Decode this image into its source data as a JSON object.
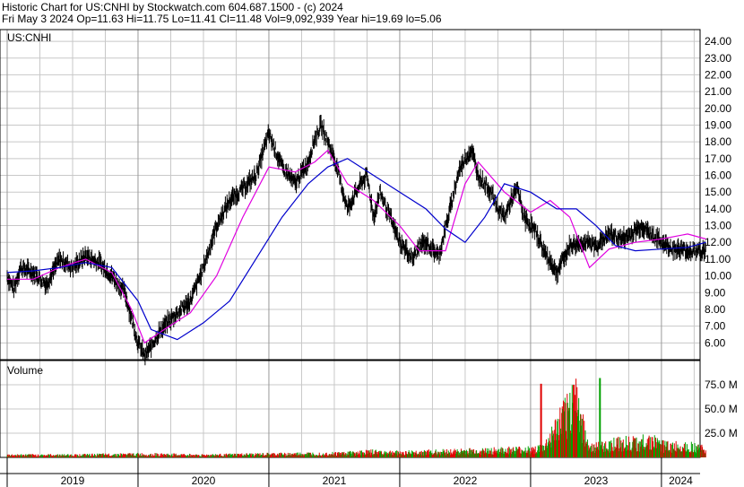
{
  "header": {
    "line1": "Historic Chart for US:CNHI by Stockwatch.com 604.687.1500 - (c) 2024",
    "line2": "Fri May  3 2024   Op=11.63  Hi=11.75  Lo=11.41  Cl=11.48  Vol=9,092,939  Year hi=19.69  lo=5.06"
  },
  "colors": {
    "price_bar": "#000000",
    "ma_short": "#e000e0",
    "ma_long": "#0000cc",
    "vol_up": "#00a000",
    "vol_down": "#e00000",
    "grid": "#c8c8c8"
  },
  "chart_data": [
    {
      "type": "line",
      "title": "US:CNHI",
      "ylim": [
        5,
        24.7
      ],
      "y_ticks": [
        "24.00",
        "23.00",
        "22.00",
        "21.00",
        "20.00",
        "19.00",
        "18.00",
        "17.00",
        "16.00",
        "15.00",
        "14.00",
        "13.00",
        "12.00",
        "11.00",
        "10.00",
        "9.00",
        "8.00",
        "7.00",
        "6.00"
      ],
      "x_ticks": [
        "2019",
        "2020",
        "2021",
        "2022",
        "2023",
        "2024"
      ],
      "x_range": [
        2019.0,
        2024.35
      ],
      "series": [
        {
          "key": "price",
          "x": [
            2019.0,
            2019.05,
            2019.1,
            2019.2,
            2019.3,
            2019.4,
            2019.5,
            2019.6,
            2019.7,
            2019.8,
            2019.9,
            2020.0,
            2020.05,
            2020.1,
            2020.15,
            2020.2,
            2020.25,
            2020.3,
            2020.4,
            2020.5,
            2020.6,
            2020.7,
            2020.8,
            2020.9,
            2021.0,
            2021.1,
            2021.2,
            2021.3,
            2021.35,
            2021.4,
            2021.5,
            2021.6,
            2021.7,
            2021.75,
            2021.8,
            2021.85,
            2021.9,
            2022.0,
            2022.1,
            2022.15,
            2022.2,
            2022.3,
            2022.4,
            2022.45,
            2022.5,
            2022.55,
            2022.6,
            2022.7,
            2022.75,
            2022.8,
            2022.85,
            2022.9,
            2022.95,
            2023.0,
            2023.05,
            2023.1,
            2023.2,
            2023.3,
            2023.4,
            2023.5,
            2023.6,
            2023.7,
            2023.75,
            2023.8,
            2023.85,
            2023.9,
            2024.0,
            2024.1,
            2024.2,
            2024.25,
            2024.3,
            2024.34
          ],
          "values": [
            10.0,
            9.2,
            10.5,
            10.2,
            9.5,
            11.0,
            10.5,
            11.2,
            10.8,
            10.0,
            9.0,
            6.0,
            5.2,
            5.8,
            6.5,
            7.0,
            7.4,
            7.8,
            8.5,
            10.5,
            13.0,
            14.5,
            15.2,
            16.0,
            18.5,
            16.5,
            15.5,
            16.8,
            18.2,
            19.0,
            17.0,
            14.0,
            15.5,
            16.0,
            13.5,
            15.0,
            14.0,
            12.0,
            11.0,
            11.8,
            12.0,
            11.2,
            14.5,
            16.2,
            17.0,
            17.5,
            16.0,
            15.0,
            14.0,
            13.5,
            14.5,
            15.2,
            13.5,
            13.0,
            12.5,
            11.5,
            10.2,
            11.8,
            12.0,
            11.8,
            12.5,
            12.2,
            12.4,
            12.7,
            13.0,
            12.6,
            12.0,
            11.6,
            11.5,
            11.5,
            11.5,
            11.48
          ]
        },
        {
          "key": "ma_short",
          "name": "",
          "x": [
            2019.0,
            2019.2,
            2019.4,
            2019.6,
            2019.8,
            2019.95,
            2020.05,
            2020.2,
            2020.4,
            2020.6,
            2020.8,
            2021.0,
            2021.2,
            2021.35,
            2021.45,
            2021.6,
            2021.8,
            2022.0,
            2022.15,
            2022.35,
            2022.5,
            2022.6,
            2022.8,
            2023.0,
            2023.15,
            2023.3,
            2023.45,
            2023.6,
            2023.8,
            2024.0,
            2024.2,
            2024.34
          ],
          "values": [
            9.8,
            9.8,
            10.5,
            11.0,
            10.2,
            8.0,
            6.0,
            6.8,
            7.8,
            10.0,
            13.5,
            16.5,
            16.2,
            16.8,
            17.5,
            15.5,
            14.5,
            13.0,
            11.5,
            11.5,
            15.5,
            16.8,
            15.0,
            13.8,
            14.5,
            13.5,
            10.5,
            11.6,
            12.0,
            12.2,
            12.5,
            12.2
          ]
        },
        {
          "key": "ma_long",
          "name": "",
          "x": [
            2019.0,
            2019.2,
            2019.4,
            2019.6,
            2019.8,
            2020.0,
            2020.1,
            2020.3,
            2020.5,
            2020.7,
            2020.9,
            2021.1,
            2021.3,
            2021.45,
            2021.6,
            2021.8,
            2022.0,
            2022.2,
            2022.35,
            2022.5,
            2022.65,
            2022.8,
            2023.0,
            2023.2,
            2023.35,
            2023.5,
            2023.65,
            2023.8,
            2024.0,
            2024.2,
            2024.34
          ],
          "values": [
            10.2,
            10.3,
            10.5,
            10.8,
            10.5,
            8.5,
            6.8,
            6.2,
            7.2,
            8.5,
            11.0,
            13.5,
            15.5,
            16.5,
            17.0,
            16.0,
            15.0,
            14.0,
            12.8,
            12.0,
            13.5,
            15.5,
            15.0,
            14.0,
            14.0,
            13.0,
            11.8,
            11.5,
            11.6,
            11.7,
            12.0
          ]
        }
      ]
    },
    {
      "type": "bar",
      "title": "Volume",
      "ylim": [
        0,
        100
      ],
      "y_ticks": [
        "75.0 M",
        "50.0 M",
        "25.0 M"
      ],
      "x": [
        2019.0,
        2019.5,
        2020.0,
        2020.5,
        2021.0,
        2021.5,
        2021.8,
        2022.0,
        2022.5,
        2023.0,
        2023.1,
        2023.35,
        2023.45,
        2023.55,
        2023.7,
        2023.8,
        2023.9,
        2024.0,
        2024.1,
        2024.2,
        2024.3,
        2024.34
      ],
      "values": [
        3,
        3,
        4,
        3,
        4,
        5,
        7,
        6,
        8,
        10,
        12,
        75,
        12,
        14,
        20,
        18,
        22,
        16,
        14,
        15,
        12,
        9
      ],
      "spikes": [
        {
          "x": 2023.08,
          "value": 76,
          "dir": "down"
        },
        {
          "x": 2023.33,
          "value": 75,
          "dir": "down"
        },
        {
          "x": 2023.53,
          "value": 82,
          "dir": "up"
        }
      ]
    }
  ]
}
